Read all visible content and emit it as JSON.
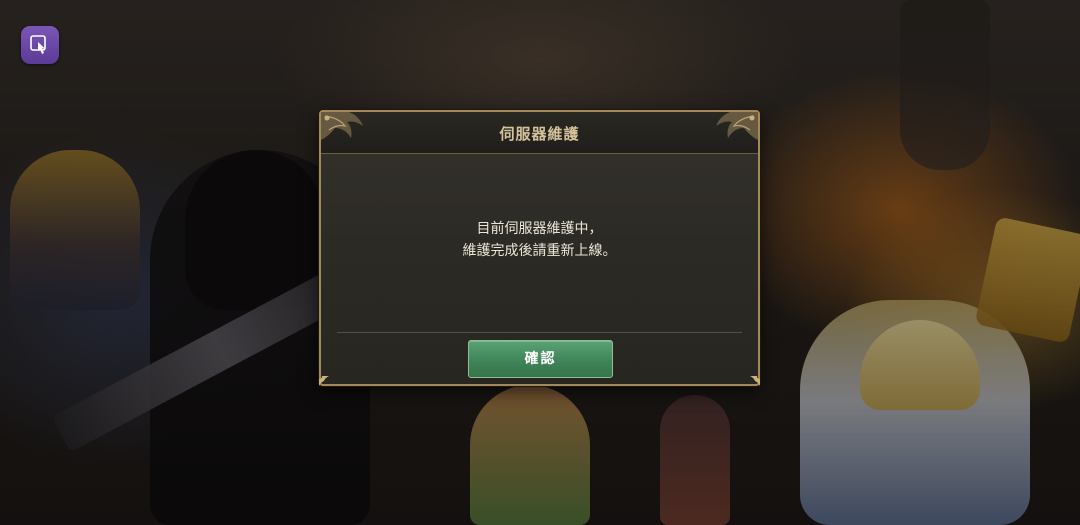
{
  "background": {
    "scene": "game-key-art"
  },
  "corner_button": {
    "icon": "touch-hand-icon",
    "color": "#6b48a8"
  },
  "dialog": {
    "title": "伺服器維護",
    "message_lines": [
      "目前伺服器維護中，",
      "維護完成後請重新上線。"
    ],
    "confirm_label": "確認",
    "accent_color": "#a3895a",
    "button_color": "#4a9466"
  }
}
